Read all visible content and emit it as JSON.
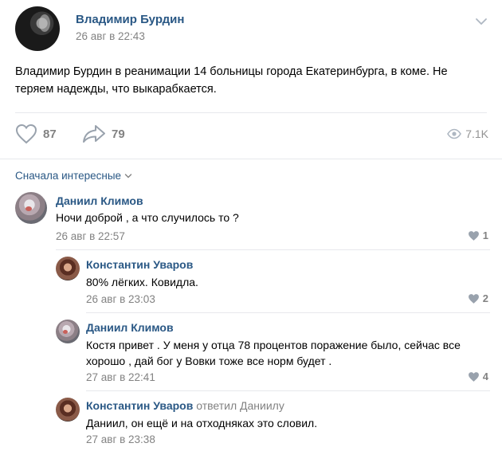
{
  "post": {
    "author": "Владимир Бурдин",
    "date": "26 авг в 22:43",
    "text": "Владимир Бурдин в реанимации 14 больницы города Екатеринбурга, в коме. Не теряем надежды, что выкарабкается.",
    "likes": "87",
    "shares": "79",
    "views": "7.1K"
  },
  "comments_header": {
    "sort_label": "Сначала интересные"
  },
  "comments": [
    {
      "author": "Даниил Климов",
      "text": "Ночи доброй , а что случилось то ?",
      "date": "26 авг в 22:57",
      "likes": "1"
    },
    {
      "author": "Константин Уваров",
      "text": "80% лёгких. Ковидла.",
      "date": "26 авг в 23:03",
      "likes": "2"
    },
    {
      "author": "Даниил Климов",
      "text": "Костя привет . У меня у отца 78 процентов поражение было, сейчас все хорошо , дай бог у Вовки тоже все норм будет .",
      "date": "27 авг в 22:41",
      "likes": "4"
    },
    {
      "author": "Константин Уваров",
      "replied_to": "ответил Даниилу",
      "text": "Даниил, он ещё и на отходняках это словил.",
      "date": "27 авг в 23:38"
    }
  ],
  "icons": {
    "like": "heart-icon",
    "share": "share-arrow-icon",
    "views": "eye-icon",
    "menu": "chevron-down-icon"
  },
  "colors": {
    "link": "#2a5885",
    "secondary": "#828282",
    "divider": "#e7e8ec"
  }
}
